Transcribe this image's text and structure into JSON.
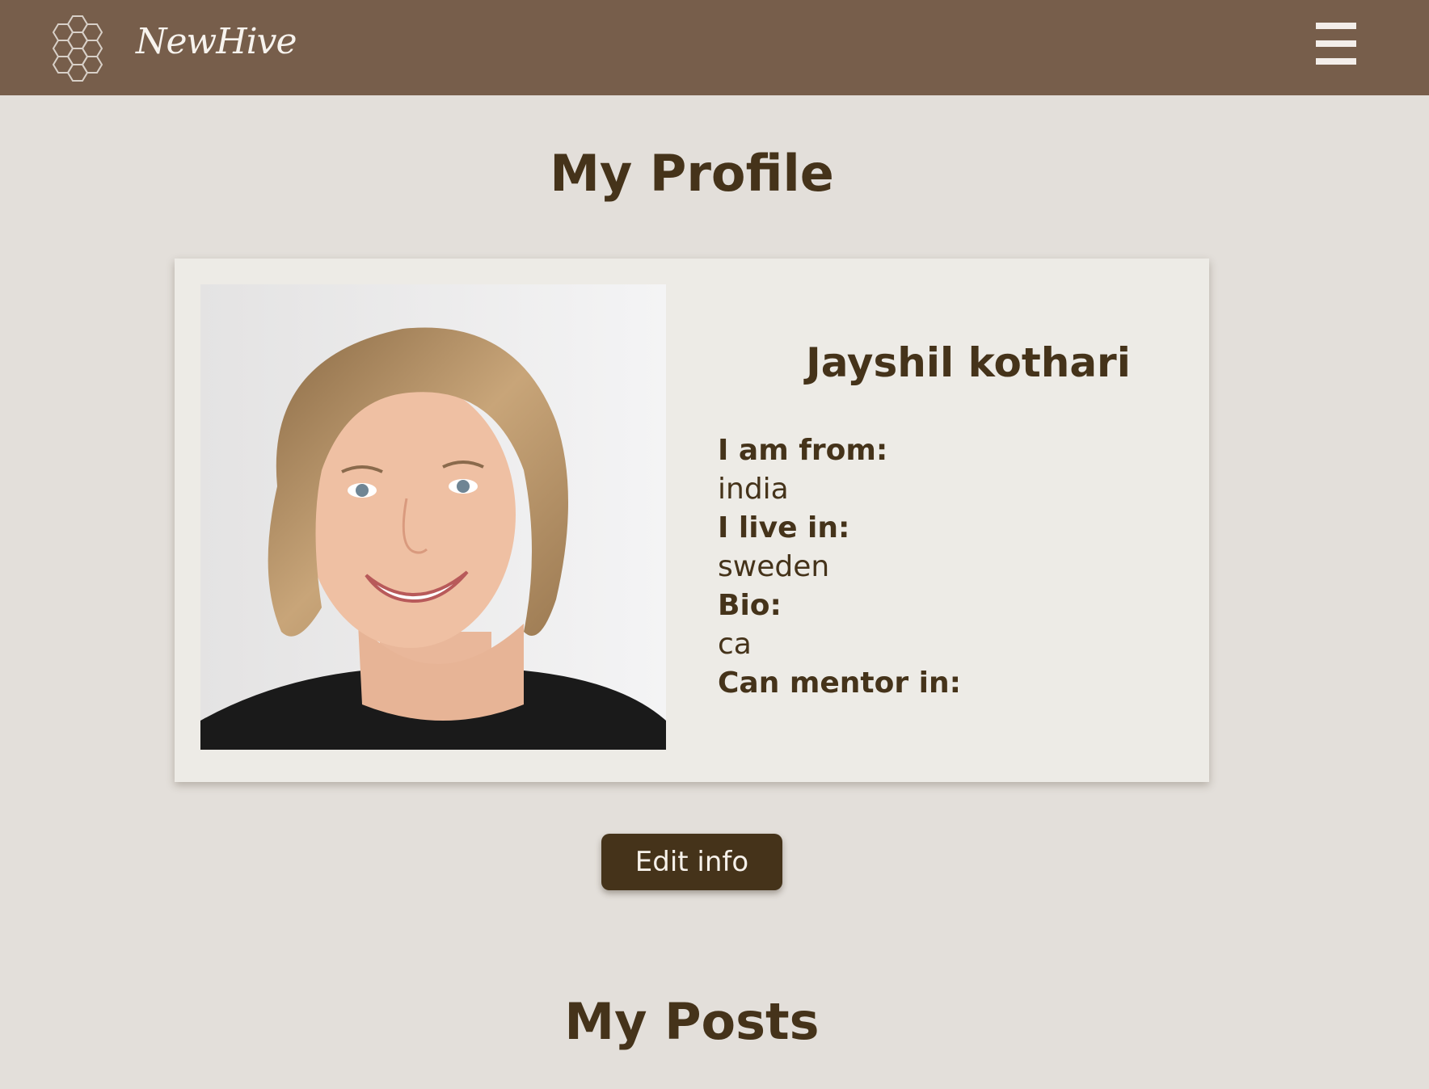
{
  "header": {
    "brand": "NewHive",
    "logo_icon": "honeycomb-icon",
    "menu_icon": "hamburger-menu-icon",
    "background_color": "#775e4b"
  },
  "profile": {
    "title": "My Profile",
    "name": "Jayshil kothari",
    "from_label": "I am from:",
    "from_value": "india",
    "live_label": "I live in:",
    "live_value": "sweden",
    "bio_label": "Bio:",
    "bio_value": "ca",
    "mentor_label": "Can mentor in:",
    "mentor_value": ""
  },
  "actions": {
    "edit_label": "Edit info",
    "button_color": "#45331a"
  },
  "posts": {
    "title": "My Posts"
  }
}
